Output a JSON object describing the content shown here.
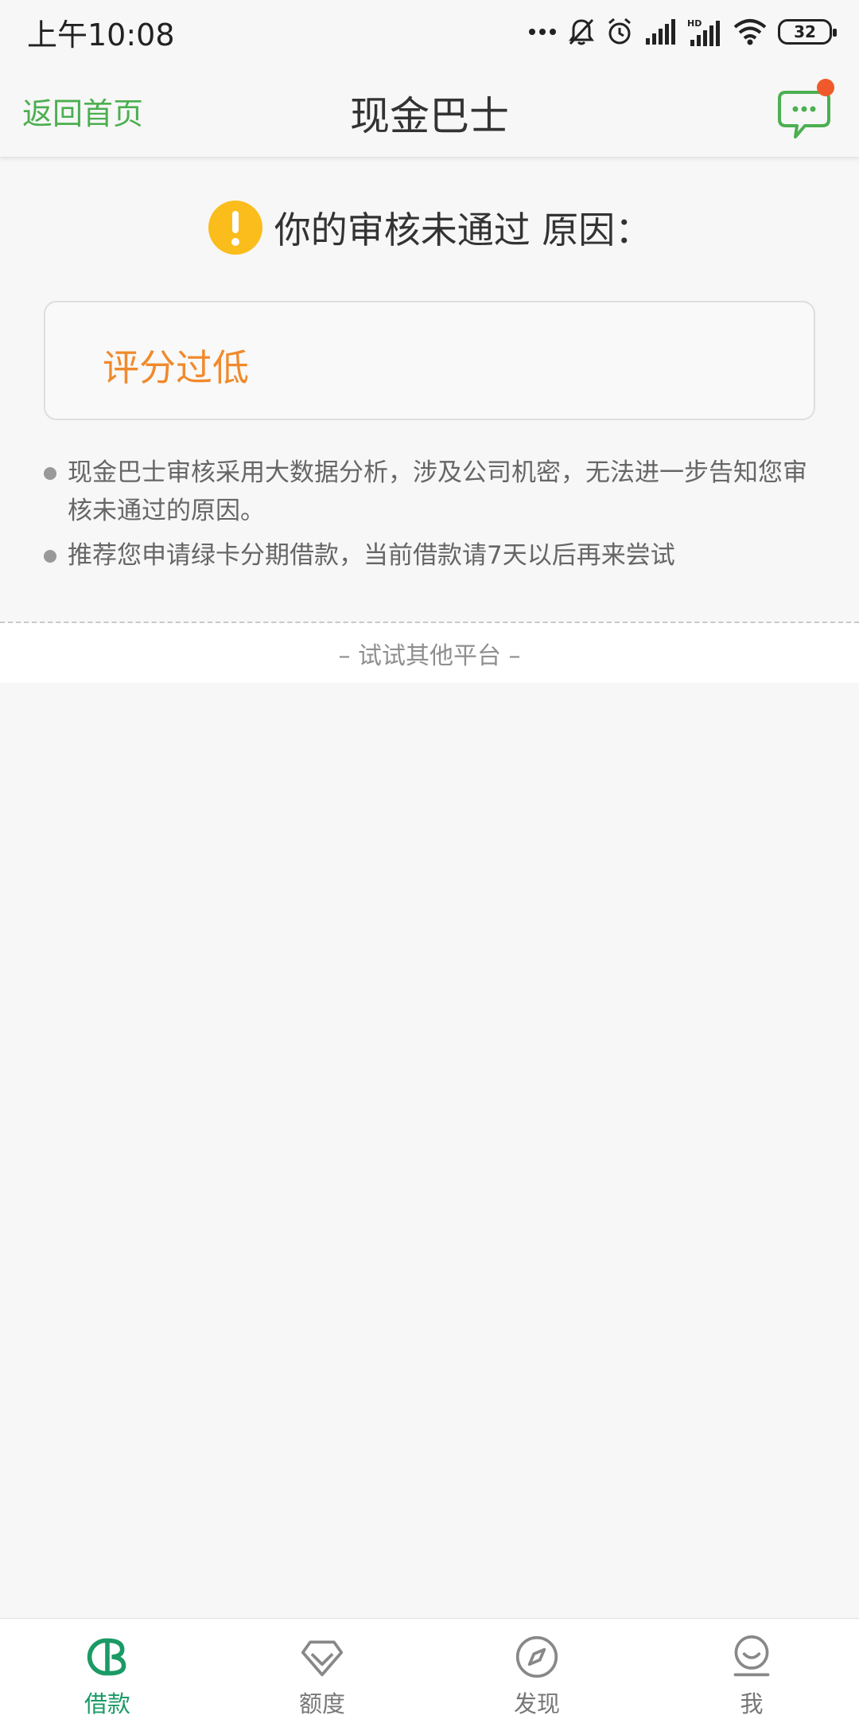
{
  "status_bar": {
    "time": "上午10:08",
    "battery": "32"
  },
  "nav": {
    "back_label": "返回首页",
    "title": "现金巴士",
    "accent_color": "#4caf50",
    "badge_color": "#f0592a"
  },
  "review": {
    "header": "你的审核未通过 原因：",
    "reason": "评分过低",
    "reason_color": "#f08a2c",
    "notes": [
      "现金巴士审核采用大数据分析，涉及公司机密，无法进一步告知您审核未通过的原因。",
      "推荐您申请绿卡分期借款，当前借款请7天以后再来尝试"
    ]
  },
  "other": {
    "label": "– 试试其他平台 –"
  },
  "tabs": [
    {
      "label": "借款",
      "icon": "loan-icon",
      "active": true
    },
    {
      "label": "额度",
      "icon": "diamond-icon",
      "active": false
    },
    {
      "label": "发现",
      "icon": "compass-icon",
      "active": false
    },
    {
      "label": "我",
      "icon": "profile-icon",
      "active": false
    }
  ]
}
